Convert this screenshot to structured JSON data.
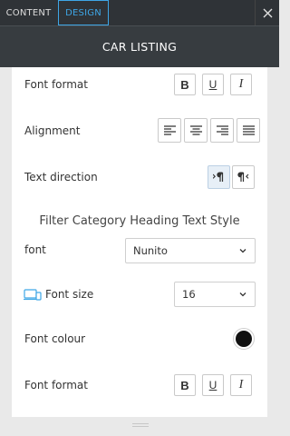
{
  "tabs": [
    {
      "label": "CONTENT",
      "active": false
    },
    {
      "label": "DESIGN",
      "active": true
    }
  ],
  "close_icon": "close-icon",
  "header": {
    "title": "CAR LISTING"
  },
  "rows": {
    "font_format_1": {
      "label": "Font format",
      "buttons": [
        "B",
        "U",
        "I"
      ]
    },
    "alignment": {
      "label": "Alignment",
      "icons": [
        "align-left-icon",
        "align-center-icon",
        "align-right-icon",
        "align-justify-icon"
      ]
    },
    "text_direction": {
      "label": "Text direction",
      "icons": [
        "ltr-icon",
        "rtl-icon"
      ],
      "selected": "ltr-icon"
    }
  },
  "section": {
    "title": "Filter Category Heading Text Style"
  },
  "font": {
    "label": "font",
    "value": "Nunito"
  },
  "font_size": {
    "label": "Font size",
    "value": "16",
    "icon": "devices-icon"
  },
  "font_colour": {
    "label": "Font colour",
    "color": "#111111"
  },
  "font_format_2": {
    "label": "Font format",
    "buttons": [
      "B",
      "U",
      "I"
    ]
  },
  "colors": {
    "accent": "#3ea6e6",
    "tabbar": "#2f3337",
    "header": "#373c40"
  }
}
